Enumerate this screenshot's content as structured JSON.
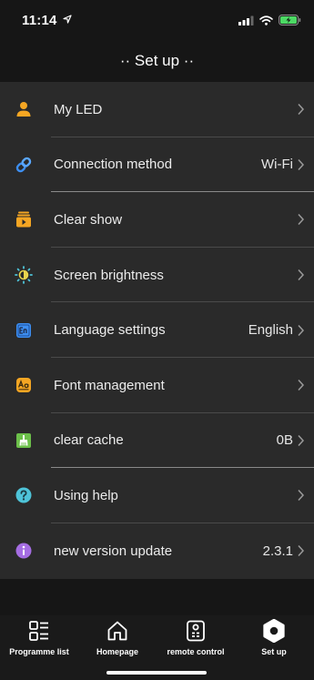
{
  "status_bar": {
    "time": "11:14"
  },
  "header": {
    "title": "·· Set up ··"
  },
  "settings": {
    "items": [
      {
        "label": "My LED",
        "value": "",
        "icon": "user-icon",
        "icon_color": "#f5a623"
      },
      {
        "label": "Connection method",
        "value": "Wi-Fi",
        "icon": "link-icon",
        "icon_color": "#3d8ef0"
      },
      {
        "label": "Clear show",
        "value": "",
        "icon": "play-box-icon",
        "icon_color": "#f5a623"
      },
      {
        "label": "Screen brightness",
        "value": "",
        "icon": "brightness-icon",
        "icon_color": "#4ec3d8"
      },
      {
        "label": "Language settings",
        "value": "English",
        "icon": "language-icon",
        "icon_color": "#3d8ef0"
      },
      {
        "label": "Font management",
        "value": "",
        "icon": "font-icon",
        "icon_color": "#f5a623"
      },
      {
        "label": "clear cache",
        "value": "0B",
        "icon": "broom-icon",
        "icon_color": "#6cc04a"
      },
      {
        "label": "Using help",
        "value": "",
        "icon": "help-icon",
        "icon_color": "#4ec3d8"
      },
      {
        "label": "new version update",
        "value": "2.3.1",
        "icon": "info-icon",
        "icon_color": "#a56de2"
      }
    ]
  },
  "tab_bar": {
    "tabs": [
      {
        "label": "Programme list",
        "icon": "grid-list-icon"
      },
      {
        "label": "Homepage",
        "icon": "home-icon"
      },
      {
        "label": "remote control",
        "icon": "remote-icon"
      },
      {
        "label": "Set up",
        "icon": "settings-gear-icon"
      }
    ]
  }
}
